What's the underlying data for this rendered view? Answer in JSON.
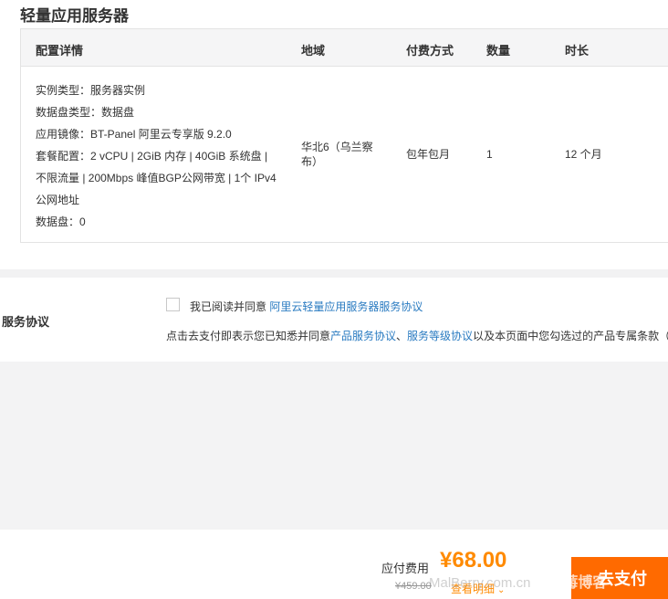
{
  "page_title": "轻量应用服务器",
  "table": {
    "headers": {
      "config": "配置详情",
      "region": "地域",
      "payment": "付费方式",
      "quantity": "数量",
      "duration": "时长"
    },
    "row": {
      "config_lines": [
        "实例类型：服务器实例",
        "数据盘类型：数据盘",
        "应用镜像：BT-Panel 阿里云专享版 9.2.0",
        "套餐配置：2 vCPU | 2GiB 内存 | 40GiB 系统盘 |",
        "不限流量 | 200Mbps 峰值BGP公网带宽 | 1个 IPv4",
        "公网地址",
        "数据盘：0"
      ],
      "region": "华北6（乌兰察布）",
      "payment": "包年包月",
      "quantity": "1",
      "duration": "12 个月"
    }
  },
  "agreement": {
    "title": "服务协议",
    "checked": false,
    "checkbox_text": "我已阅读并同意",
    "checkbox_link": "阿里云轻量应用服务器服务协议",
    "note_prefix": "点击去支付即表示您已知悉并同意",
    "note_link1": "产品服务协议",
    "note_sep": "、",
    "note_link2": "服务等级协议",
    "note_suffix": "以及本页面中您勾选过的产品专属条款（"
  },
  "footer": {
    "fee_label": "应付费用",
    "fee_amount": "¥68.00",
    "fee_original": "¥459.00",
    "fee_detail": "查看明细",
    "pay_button": "去支付"
  },
  "watermark": {
    "text": "MalBerry.com.cn",
    "divider": "|",
    "cn": "邮莓博客"
  },
  "colors": {
    "accent": "#ff6a00",
    "price": "#ff8a00",
    "link": "#2a7bc1",
    "header_bg": "#f5f5f6",
    "band_bg": "#f3f3f4"
  },
  "icons": {
    "detail_chevron": "chevron-down-icon",
    "checkbox": "checkbox-icon"
  }
}
